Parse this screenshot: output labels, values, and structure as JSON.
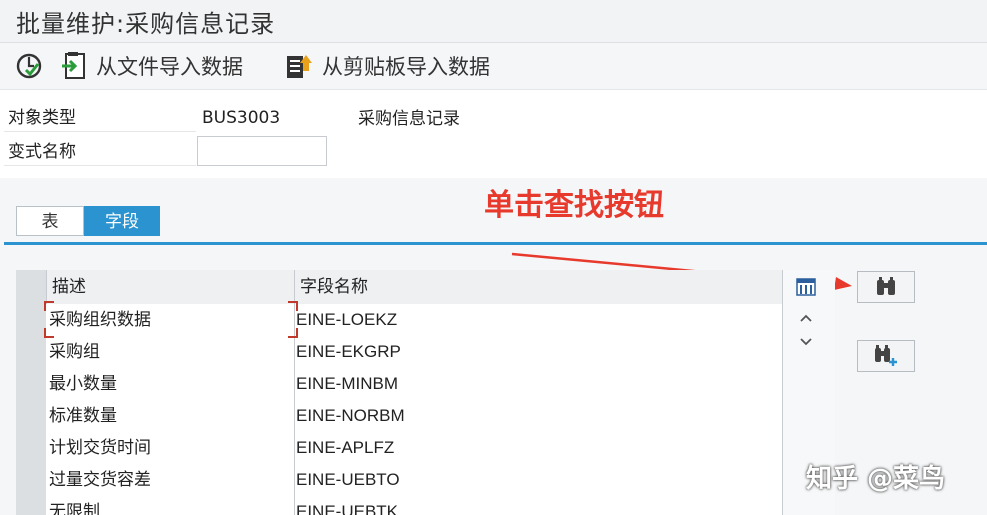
{
  "window": {
    "title": "批量维护:采购信息记录"
  },
  "toolbar": {
    "import_file_label": "从文件导入数据",
    "import_clipboard_label": "从剪贴板导入数据"
  },
  "form": {
    "object_type_label": "对象类型",
    "object_type_value": "BUS3003",
    "object_type_desc": "采购信息记录",
    "variant_name_label": "变式名称",
    "variant_name_value": ""
  },
  "annotation": {
    "text": "单击查找按钮",
    "color": "#e8392d"
  },
  "tabs": [
    {
      "label": "表",
      "active": false
    },
    {
      "label": "字段",
      "active": true
    }
  ],
  "grid": {
    "headers": [
      "描述",
      "字段名称"
    ],
    "rows": [
      {
        "desc": "采购组织数据",
        "field": "EINE-LOEKZ"
      },
      {
        "desc": "采购组",
        "field": "EINE-EKGRP"
      },
      {
        "desc": "最小数量",
        "field": "EINE-MINBM"
      },
      {
        "desc": "标准数量",
        "field": "EINE-NORBM"
      },
      {
        "desc": "计划交货时间",
        "field": "EINE-APLFZ"
      },
      {
        "desc": "过量交货容差",
        "field": "EINE-UEBTO"
      },
      {
        "desc": "无限制",
        "field": "EINE-UEBTK"
      }
    ]
  },
  "watermark": {
    "text": "知乎 @菜鸟"
  },
  "colors": {
    "accent": "#2b93cf",
    "annotation": "#e8392d"
  },
  "icons": [
    "execute-check-icon",
    "import-file-icon",
    "clipboard-icon",
    "column-settings-icon",
    "scroll-up-icon",
    "scroll-down-icon",
    "find-binoculars-icon",
    "find-next-binoculars-icon"
  ]
}
